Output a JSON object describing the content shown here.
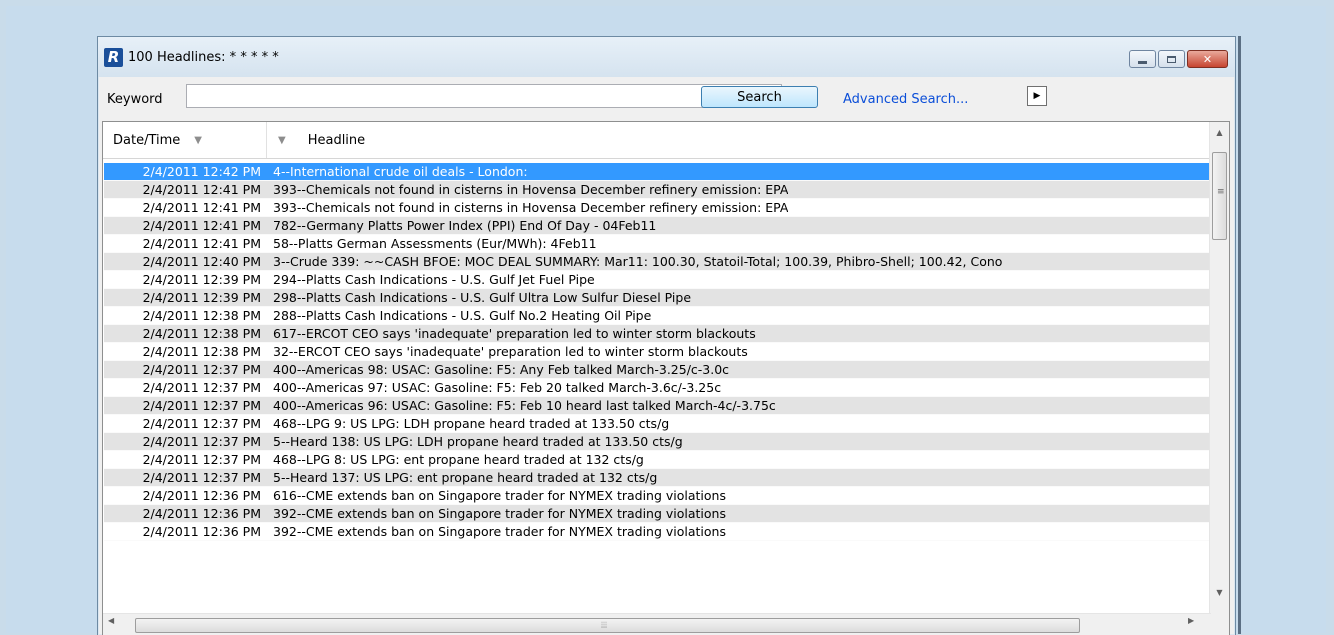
{
  "window": {
    "icon_letter": "R",
    "title": "100 Headlines: * * * * *",
    "minimize_icon": "minimize-icon",
    "maximize_icon": "maximize-icon",
    "close_label": "✕"
  },
  "toolbar": {
    "keyword_label": "Keyword",
    "keyword_value": "",
    "search_label": "Search",
    "advanced_search_label": "Advanced Search...",
    "arrow_label": "▶"
  },
  "grid": {
    "columns": [
      "Date/Time",
      "Headline"
    ],
    "selected_row": 0,
    "rows": [
      {
        "dt": "2/4/2011 12:42 PM",
        "headline": "4--International crude oil deals - London:"
      },
      {
        "dt": "2/4/2011 12:41 PM",
        "headline": "393--Chemicals not found in cisterns in Hovensa December refinery emission: EPA"
      },
      {
        "dt": "2/4/2011 12:41 PM",
        "headline": "393--Chemicals not found in cisterns in Hovensa December refinery emission: EPA"
      },
      {
        "dt": "2/4/2011 12:41 PM",
        "headline": "782--Germany Platts Power Index (PPI) End Of Day - 04Feb11"
      },
      {
        "dt": "2/4/2011 12:41 PM",
        "headline": "58--Platts German Assessments (Eur/MWh): 4Feb11"
      },
      {
        "dt": "2/4/2011 12:40 PM",
        "headline": "3--Crude 339: ~~CASH BFOE: MOC DEAL SUMMARY: Mar11: 100.30, Statoil-Total; 100.39, Phibro-Shell; 100.42, Cono"
      },
      {
        "dt": "2/4/2011 12:39 PM",
        "headline": "294--Platts Cash Indications - U.S. Gulf Jet Fuel Pipe"
      },
      {
        "dt": "2/4/2011 12:39 PM",
        "headline": "298--Platts Cash Indications - U.S. Gulf Ultra Low Sulfur Diesel Pipe"
      },
      {
        "dt": "2/4/2011 12:38 PM",
        "headline": "288--Platts Cash Indications - U.S. Gulf No.2 Heating Oil Pipe"
      },
      {
        "dt": "2/4/2011 12:38 PM",
        "headline": "617--ERCOT CEO says 'inadequate' preparation led to winter storm blackouts"
      },
      {
        "dt": "2/4/2011 12:38 PM",
        "headline": "32--ERCOT CEO says 'inadequate' preparation led to winter storm blackouts"
      },
      {
        "dt": "2/4/2011 12:37 PM",
        "headline": "400--Americas  98: USAC: Gasoline: F5: Any Feb talked March-3.25/c-3.0c"
      },
      {
        "dt": "2/4/2011 12:37 PM",
        "headline": "400--Americas  97: USAC: Gasoline: F5: Feb 20 talked March-3.6c/-3.25c"
      },
      {
        "dt": "2/4/2011 12:37 PM",
        "headline": "400--Americas  96: USAC: Gasoline: F5: Feb 10 heard last talked March-4c/-3.75c"
      },
      {
        "dt": "2/4/2011 12:37 PM",
        "headline": "468--LPG 9: US LPG: LDH propane heard traded at 133.50 cts/g"
      },
      {
        "dt": "2/4/2011 12:37 PM",
        "headline": "5--Heard 138: US LPG: LDH propane heard traded at 133.50 cts/g"
      },
      {
        "dt": "2/4/2011 12:37 PM",
        "headline": "468--LPG 8: US LPG: ent propane heard traded at 132 cts/g"
      },
      {
        "dt": "2/4/2011 12:37 PM",
        "headline": "5--Heard 137: US LPG: ent propane heard traded at 132 cts/g"
      },
      {
        "dt": "2/4/2011 12:36 PM",
        "headline": "616--CME extends ban on Singapore trader for NYMEX trading violations"
      },
      {
        "dt": "2/4/2011 12:36 PM",
        "headline": "392--CME extends ban on Singapore trader for NYMEX trading violations"
      },
      {
        "dt": "2/4/2011 12:36 PM",
        "headline": "392--CME extends ban on Singapore trader for NYMEX trading violations"
      }
    ]
  },
  "colors": {
    "selection": "#3399ff",
    "link": "#0b4ed8",
    "desktop": "#c9dcea"
  }
}
